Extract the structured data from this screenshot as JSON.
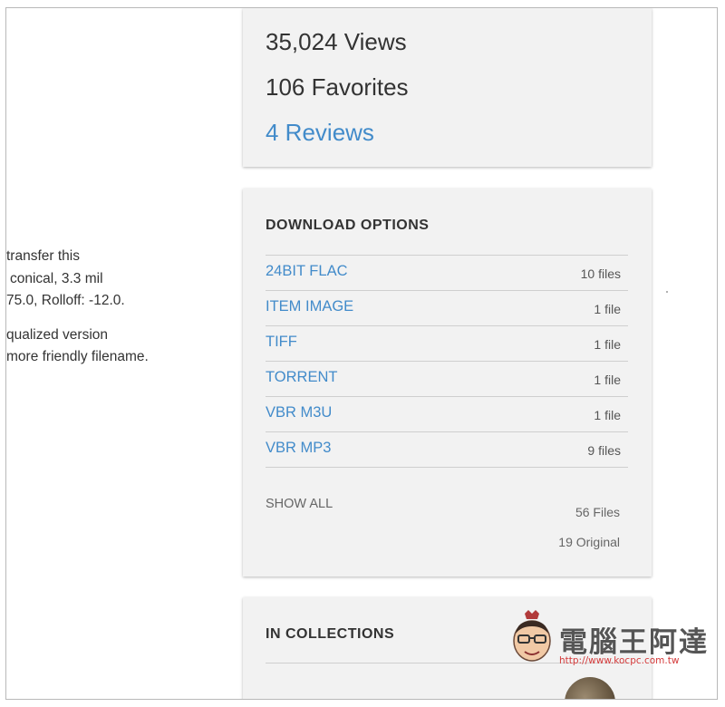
{
  "description_fragment": [
    "transfer this",
    "conical, 3.3 mil",
    "75.0, Rolloff: -12.0.",
    "qualized version",
    "more friendly filename."
  ],
  "stats": {
    "views": "35,024 Views",
    "favorites": "106 Favorites",
    "reviews": "4 Reviews"
  },
  "download_options": {
    "title": "DOWNLOAD OPTIONS",
    "rows": [
      {
        "format": "24BIT FLAC",
        "count": "10 files"
      },
      {
        "format": "ITEM IMAGE",
        "count": "1 file"
      },
      {
        "format": "TIFF",
        "count": "1 file"
      },
      {
        "format": "TORRENT",
        "count": "1 file"
      },
      {
        "format": "VBR M3U",
        "count": "1 file"
      },
      {
        "format": "VBR MP3",
        "count": "9 files"
      }
    ],
    "show_all": "SHOW ALL",
    "total_files": "56 Files",
    "original_files": "19 Original"
  },
  "collections": {
    "title": "IN COLLECTIONS"
  },
  "watermark": {
    "brand": "電腦王阿達",
    "url": "http://www.kocpc.com.tw"
  },
  "colors": {
    "link": "#428bca",
    "card_bg": "#f2f2f2",
    "text": "#333333"
  }
}
